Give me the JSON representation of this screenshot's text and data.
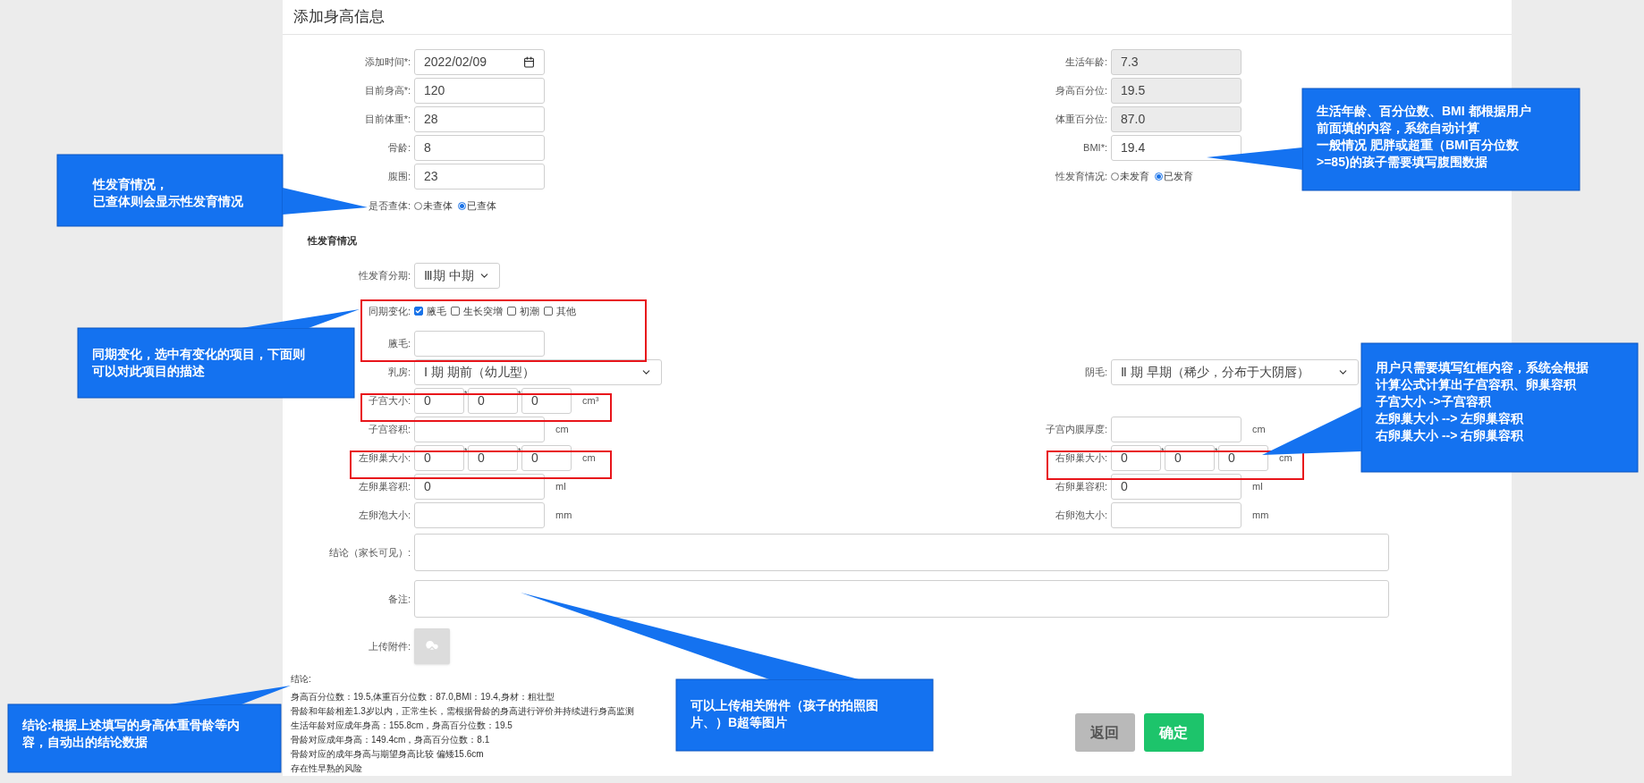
{
  "title": "添加身高信息",
  "form": {
    "rows": [
      {
        "left": {
          "kind": "date",
          "label": "添加时间*:",
          "value": "2022/02/09"
        },
        "right": {
          "kind": "readonly",
          "label": "生活年龄:",
          "value": "7.3"
        }
      },
      {
        "left": {
          "kind": "text",
          "label": "目前身高*:",
          "value": "120"
        },
        "right": {
          "kind": "readonly",
          "label": "身高百分位:",
          "value": "19.5"
        }
      },
      {
        "left": {
          "kind": "text",
          "label": "目前体重*:",
          "value": "28"
        },
        "right": {
          "kind": "readonly",
          "label": "体重百分位:",
          "value": "87.0"
        }
      },
      {
        "left": {
          "kind": "text",
          "label": "骨龄:",
          "value": "8"
        },
        "right": {
          "kind": "text",
          "label": "BMI*:",
          "value": "19.4"
        }
      },
      {
        "left": {
          "kind": "text",
          "label": "腹围:",
          "value": "23"
        },
        "right": {
          "kind": "radio",
          "label": "性发育情况:",
          "options": [
            {
              "label": "未发育",
              "selected": false
            },
            {
              "label": "已发育",
              "selected": true
            }
          ]
        }
      },
      {
        "left": {
          "kind": "radio",
          "label": "是否查体:",
          "options": [
            {
              "label": "未查体",
              "selected": false
            },
            {
              "label": "已查体",
              "selected": true
            }
          ]
        }
      },
      {
        "left": {
          "kind": "heading",
          "label": "性发育情况"
        }
      },
      {
        "left": {
          "kind": "short-select",
          "label": "性发育分期:",
          "value": "Ⅲ期 中期"
        }
      },
      {
        "left": {
          "kind": "checkboxes",
          "label": "同期变化:",
          "options": [
            {
              "label": "腋毛",
              "checked": true
            },
            {
              "label": "生长突增",
              "checked": false
            },
            {
              "label": "初潮",
              "checked": false
            },
            {
              "label": "其他",
              "checked": false
            }
          ]
        }
      },
      {
        "left": {
          "kind": "text",
          "label": "腋毛:"
        }
      },
      {
        "left": {
          "kind": "select",
          "label": "乳房:",
          "value": "Ⅰ 期 期前（幼儿型）"
        },
        "right": {
          "kind": "select",
          "label": "阴毛:",
          "value": "Ⅱ 期 早期（稀少，分布于大阴唇）"
        }
      },
      {
        "left": {
          "kind": "triple",
          "label": "子宫大小:",
          "values": [
            "0",
            "0",
            "0"
          ],
          "separators": [
            "*",
            "*"
          ],
          "unit": "cm³"
        }
      },
      {
        "left": {
          "kind": "text",
          "label": "子宫容积:",
          "unit": "cm"
        },
        "right": {
          "kind": "text",
          "label": "子宫内膜厚度:",
          "unit": "cm"
        }
      },
      {
        "left": {
          "kind": "triple",
          "label": "左卵巢大小:",
          "values": [
            "0",
            "0",
            "0"
          ],
          "separators": [
            "*",
            "*"
          ],
          "unit": "cm"
        },
        "right": {
          "kind": "triple",
          "label": "右卵巢大小:",
          "values": [
            "0",
            "0",
            "0"
          ],
          "separators": [
            "*",
            "*"
          ],
          "unit": "cm"
        }
      },
      {
        "left": {
          "kind": "text",
          "label": "左卵巢容积:",
          "value": "0",
          "unit": "ml"
        },
        "right": {
          "kind": "text",
          "label": "右卵巢容积:",
          "value": "0",
          "unit": "ml"
        }
      },
      {
        "left": {
          "kind": "text",
          "label": "左卵泡大小:",
          "unit": "mm"
        },
        "right": {
          "kind": "text",
          "label": "右卵泡大小:",
          "unit": "mm"
        }
      },
      {
        "left": {
          "kind": "textarea",
          "label": "结论（家长可见）:"
        }
      },
      {
        "left": {
          "kind": "textarea",
          "label": "备注:"
        }
      },
      {
        "left": {
          "kind": "upload",
          "label": "上传附件:"
        }
      }
    ]
  },
  "conclusion": {
    "heading": "结论:",
    "lines": [
      "身高百分位数：19.5,体重百分位数：87.0,BMI：19.4,身材：粗壮型",
      "骨龄和年龄相差1.3岁以内，正常生长，需根据骨龄的身高进行评价并持续进行身高监测",
      "生活年龄对应成年身高：155.8cm，身高百分位数：19.5",
      "骨龄对应成年身高：149.4cm，身高百分位数：8.1",
      "骨龄对应的成年身高与期望身高比较 偏矮15.6cm",
      "存在性早熟的风险"
    ]
  },
  "buttons": [
    {
      "kind": "back",
      "label": "返回"
    },
    {
      "kind": "confirm",
      "label": "确定"
    }
  ],
  "callouts": [
    {
      "lines": [
        "性发育情况，",
        "已查体则会显示性发育情况"
      ]
    },
    {
      "lines": [
        "同期变化，选中有变化的项目，下面则",
        "可以对此项目的描述"
      ]
    },
    {
      "lines": [
        "生活年龄、百分位数、BMI 都根据用户",
        "前面填的内容，系统自动计算",
        "一般情况 肥胖或超重（BMI百分位数",
        ">=85)的孩子需要填写腹围数据"
      ]
    },
    {
      "lines": [
        "用户只需要填写红框内容，系统会根据",
        "计算公式计算出子宫容积、卵巢容积",
        "子宫大小 ->子宫容积",
        "左卵巢大小 --> 左卵巢容积",
        "右卵巢大小 --> 右卵巢容积"
      ]
    },
    {
      "lines": [
        "结论:根据上述填写的身高体重骨龄等内",
        "容，自动出的结论数据"
      ]
    },
    {
      "lines": [
        "可以上传相关附件（孩子的拍照图",
        "片、）B超等图片"
      ]
    }
  ]
}
